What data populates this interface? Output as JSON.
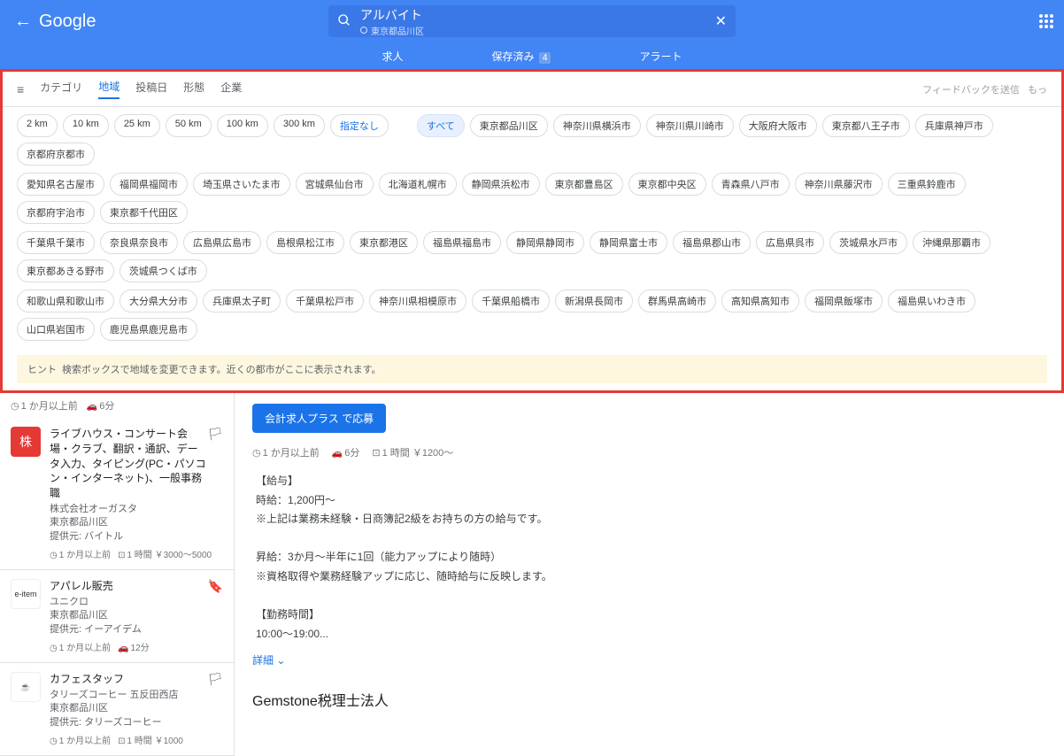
{
  "header": {
    "logo": "Google",
    "query": "アルバイト",
    "location": "東京都品川区"
  },
  "tabs": {
    "jobs": "求人",
    "saved": "保存済み",
    "saved_count": "4",
    "alerts": "アラート"
  },
  "filters": {
    "cat": "カテゴリ",
    "region": "地域",
    "posted": "投稿日",
    "type": "形態",
    "company": "企業",
    "feedback": "フィードバックを送信",
    "more": "もっ"
  },
  "distance_chips": [
    "2 km",
    "10 km",
    "25 km",
    "50 km",
    "100 km",
    "300 km"
  ],
  "distance_none": "指定なし",
  "all_chip": "すべて",
  "city_rows": [
    [
      "東京都品川区",
      "神奈川県横浜市",
      "神奈川県川崎市",
      "大阪府大阪市",
      "東京都八王子市",
      "兵庫県神戸市",
      "京都府京都市"
    ],
    [
      "愛知県名古屋市",
      "福岡県福岡市",
      "埼玉県さいたま市",
      "宮城県仙台市",
      "北海道札幌市",
      "静岡県浜松市",
      "東京都豊島区",
      "東京都中央区",
      "青森県八戸市",
      "神奈川県藤沢市",
      "三重県鈴鹿市",
      "京都府宇治市",
      "東京都千代田区"
    ],
    [
      "千葉県千葉市",
      "奈良県奈良市",
      "広島県広島市",
      "島根県松江市",
      "東京都港区",
      "福島県福島市",
      "静岡県静岡市",
      "静岡県富士市",
      "福島県郡山市",
      "広島県呉市",
      "茨城県水戸市",
      "沖縄県那覇市",
      "東京都あきる野市",
      "茨城県つくば市"
    ],
    [
      "和歌山県和歌山市",
      "大分県大分市",
      "兵庫県太子町",
      "千葉県松戸市",
      "神奈川県相模原市",
      "千葉県船橋市",
      "新潟県長岡市",
      "群馬県高崎市",
      "高知県高知市",
      "福岡県飯塚市",
      "福島県いわき市",
      "山口県岩国市",
      "鹿児島県鹿児島市"
    ]
  ],
  "hint": {
    "label": "ヒント",
    "text": "検索ボックスで地域を変更できます。近くの都市がここに表示されます。"
  },
  "list_meta": {
    "age": "1 か月以上前",
    "drive": "6分"
  },
  "jobs_list": [
    {
      "logo_text": "株",
      "logo_class": "logo-red",
      "title": "ライブハウス・コンサート会場・クラブ、翻訳・通訳、データ入力、タイピング(PC・パソコン・インターネット)、一般事務職",
      "company": "株式会社オーガスタ",
      "location": "東京都品川区",
      "source": "提供元: バイトル",
      "meta_age": "1 か月以上前",
      "meta_pay": "1 時間 ￥3000～5000",
      "bookmark_saved": false
    },
    {
      "logo_text": "e-item",
      "logo_class": "logo-img",
      "title": "アパレル販売",
      "company": "ユニクロ",
      "location": "東京都品川区",
      "source": "提供元: イーアイデム",
      "meta_age": "1 か月以上前",
      "meta_drive": "12分",
      "bookmark_saved": true
    },
    {
      "logo_text": "☕",
      "logo_class": "logo-img",
      "title": "カフェスタッフ",
      "company": "タリーズコーヒー 五反田西店",
      "location": "東京都品川区",
      "source": "提供元: タリーズコーヒー",
      "meta_age": "1 か月以上前",
      "meta_pay": "1 時間 ￥1000",
      "bookmark_saved": false
    }
  ],
  "detail": {
    "apply": "会計求人プラス で応募",
    "age": "1 か月以上前",
    "drive": "6分",
    "pay": "1 時間 ￥1200～",
    "body1": "【給与】",
    "body2": "時給：1,200円～",
    "body3": "※上記は業務未経験・日商簿記2級をお持ちの方の給与です。",
    "body4": "昇給：3か月～半年に1回（能力アップにより随時）",
    "body5": "※資格取得や業務経験アップに応じ、随時給与に反映します。",
    "body6": "【勤務時間】",
    "body7": "10:00～19:00...",
    "more": "詳細",
    "company": "Gemstone税理士法人"
  }
}
